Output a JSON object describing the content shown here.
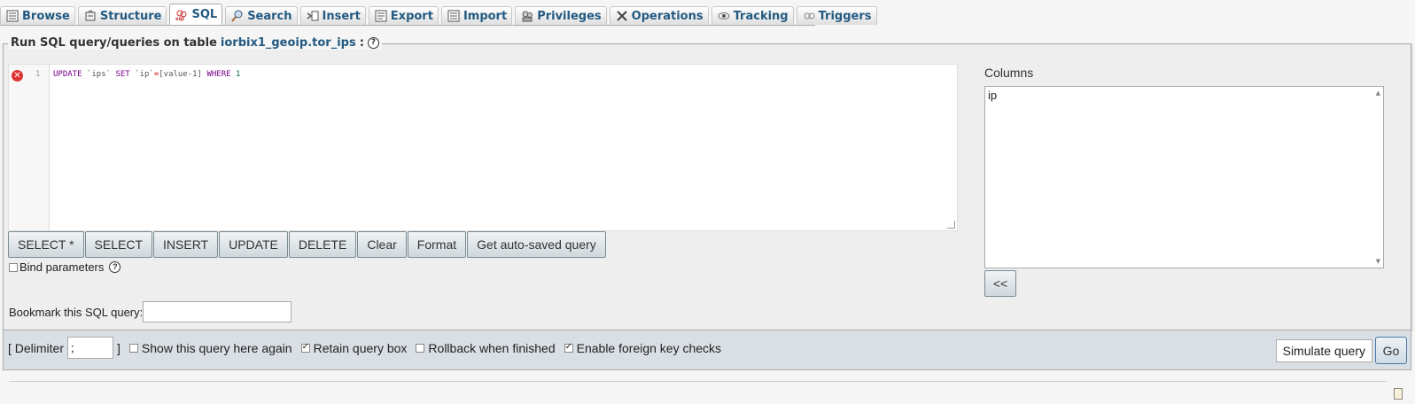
{
  "tabs": [
    {
      "label": "Browse",
      "icon": "browse-icon",
      "active": false
    },
    {
      "label": "Structure",
      "icon": "structure-icon",
      "active": false
    },
    {
      "label": "SQL",
      "icon": "sql-icon",
      "active": true
    },
    {
      "label": "Search",
      "icon": "search-icon",
      "active": false
    },
    {
      "label": "Insert",
      "icon": "insert-icon",
      "active": false
    },
    {
      "label": "Export",
      "icon": "export-icon",
      "active": false
    },
    {
      "label": "Import",
      "icon": "import-icon",
      "active": false
    },
    {
      "label": "Privileges",
      "icon": "privileges-icon",
      "active": false
    },
    {
      "label": "Operations",
      "icon": "operations-icon",
      "active": false
    },
    {
      "label": "Tracking",
      "icon": "tracking-icon",
      "active": false
    },
    {
      "label": "Triggers",
      "icon": "triggers-icon",
      "active": false
    }
  ],
  "query_panel": {
    "legend_prefix": "Run SQL query/queries on table",
    "table_link": "iorbix1_geoip.tor_ips",
    "legend_suffix": ":"
  },
  "editor": {
    "line_number": "1",
    "tokens": {
      "update": "UPDATE",
      "table": "`ips`",
      "set": "SET",
      "column": "`ip`",
      "eq": "=",
      "value": "[value-1]",
      "where": "WHERE",
      "one": "1"
    }
  },
  "buttons": {
    "select_star": "SELECT *",
    "select": "SELECT",
    "insert": "INSERT",
    "update": "UPDATE",
    "delete": "DELETE",
    "clear": "Clear",
    "format": "Format",
    "autosaved": "Get auto-saved query"
  },
  "bind_parameters": {
    "label": "Bind parameters",
    "checked": false
  },
  "bookmark": {
    "label": "Bookmark this SQL query:",
    "value": ""
  },
  "columns": {
    "label": "Columns",
    "items": [
      "ip"
    ],
    "insert_button": "<<"
  },
  "bottom_bar": {
    "delimiter_open": "[ Delimiter",
    "delimiter_value": ";",
    "delimiter_close": "]",
    "show_again": {
      "label": "Show this query here again",
      "checked": false
    },
    "retain_box": {
      "label": "Retain query box",
      "checked": true
    },
    "rollback": {
      "label": "Rollback when finished",
      "checked": false
    },
    "foreign_keys": {
      "label": "Enable foreign key checks",
      "checked": true
    },
    "simulate": "Simulate query",
    "go": "Go"
  }
}
